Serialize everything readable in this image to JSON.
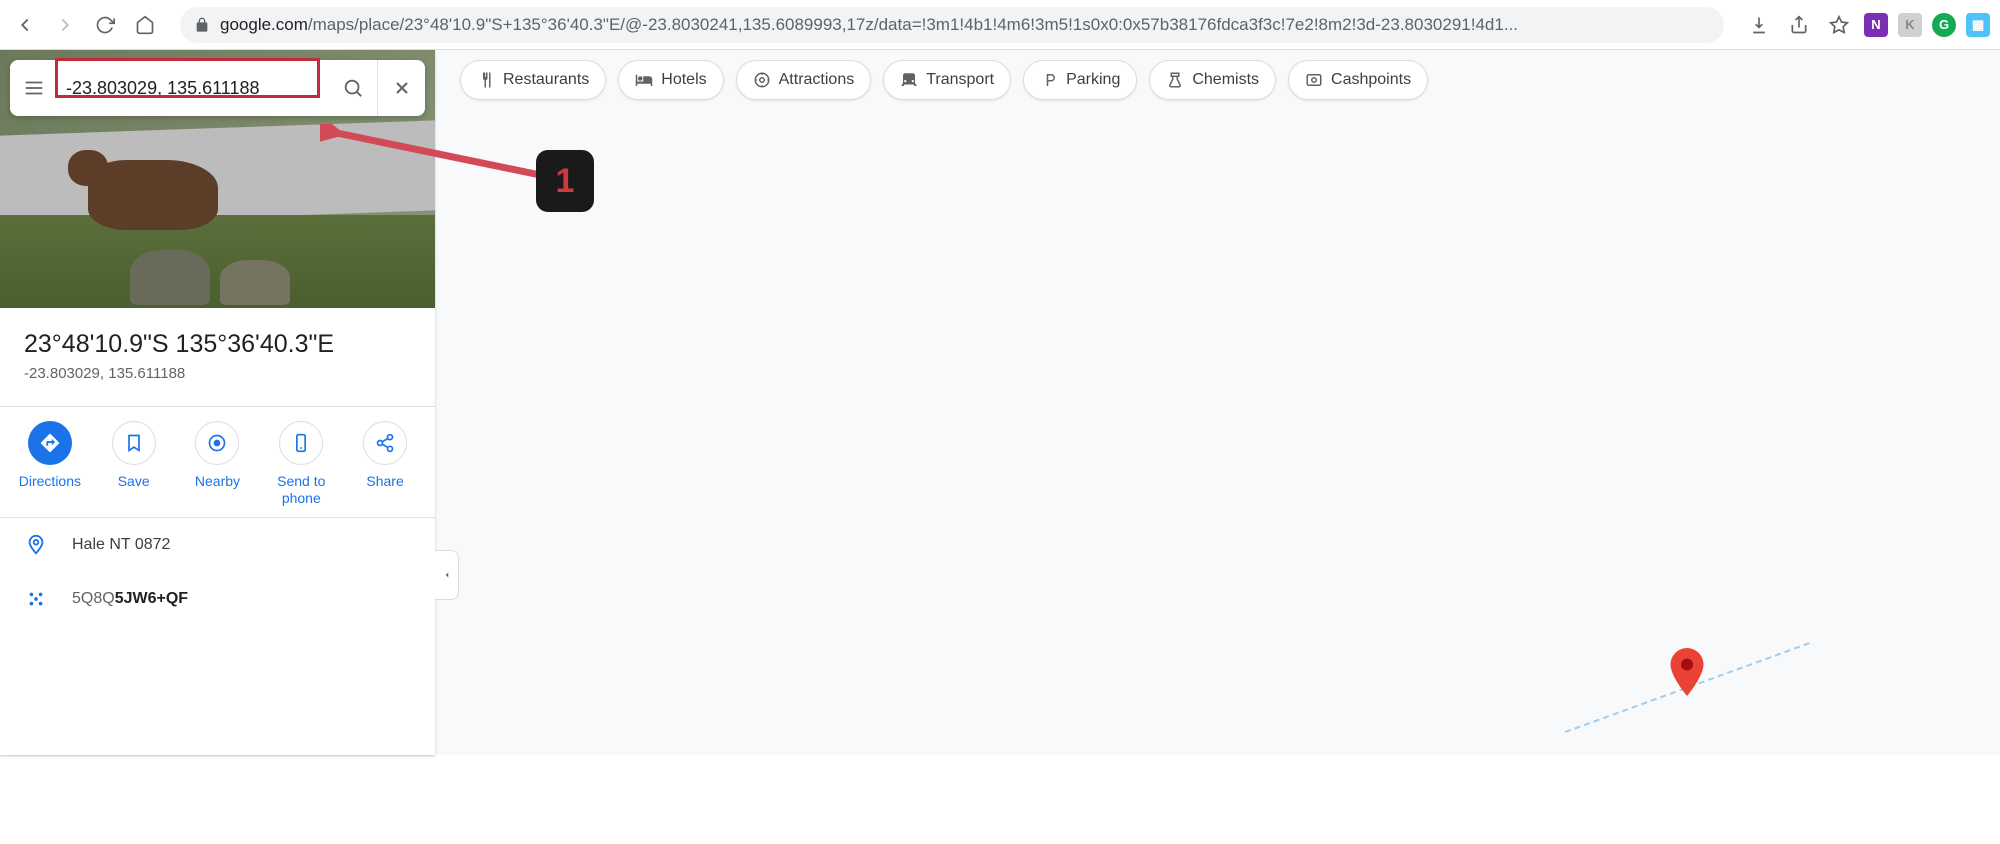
{
  "browser": {
    "url_domain": "google.com",
    "url_path": "/maps/place/23°48'10.9\"S+135°36'40.3\"E/@-23.8030241,135.6089993,17z/data=!3m1!4b1!4m6!3m5!1s0x0:0x57b38176fdca3f3c!7e2!8m2!3d-23.8030291!4d1..."
  },
  "search": {
    "value": "-23.803029, 135.611188"
  },
  "chips": [
    {
      "label": "Restaurants"
    },
    {
      "label": "Hotels"
    },
    {
      "label": "Attractions"
    },
    {
      "label": "Transport"
    },
    {
      "label": "Parking"
    },
    {
      "label": "Chemists"
    },
    {
      "label": "Cashpoints"
    }
  ],
  "place": {
    "title": "23°48'10.9\"S 135°36'40.3\"E",
    "sub": "-23.803029, 135.611188",
    "address": "Hale NT 0872",
    "plus_prefix": "5Q8Q",
    "plus_suffix": "5JW6+QF"
  },
  "actions": {
    "directions": "Directions",
    "save": "Save",
    "nearby": "Nearby",
    "send": "Send to phone",
    "share": "Share"
  },
  "annotation": {
    "num": "1"
  }
}
